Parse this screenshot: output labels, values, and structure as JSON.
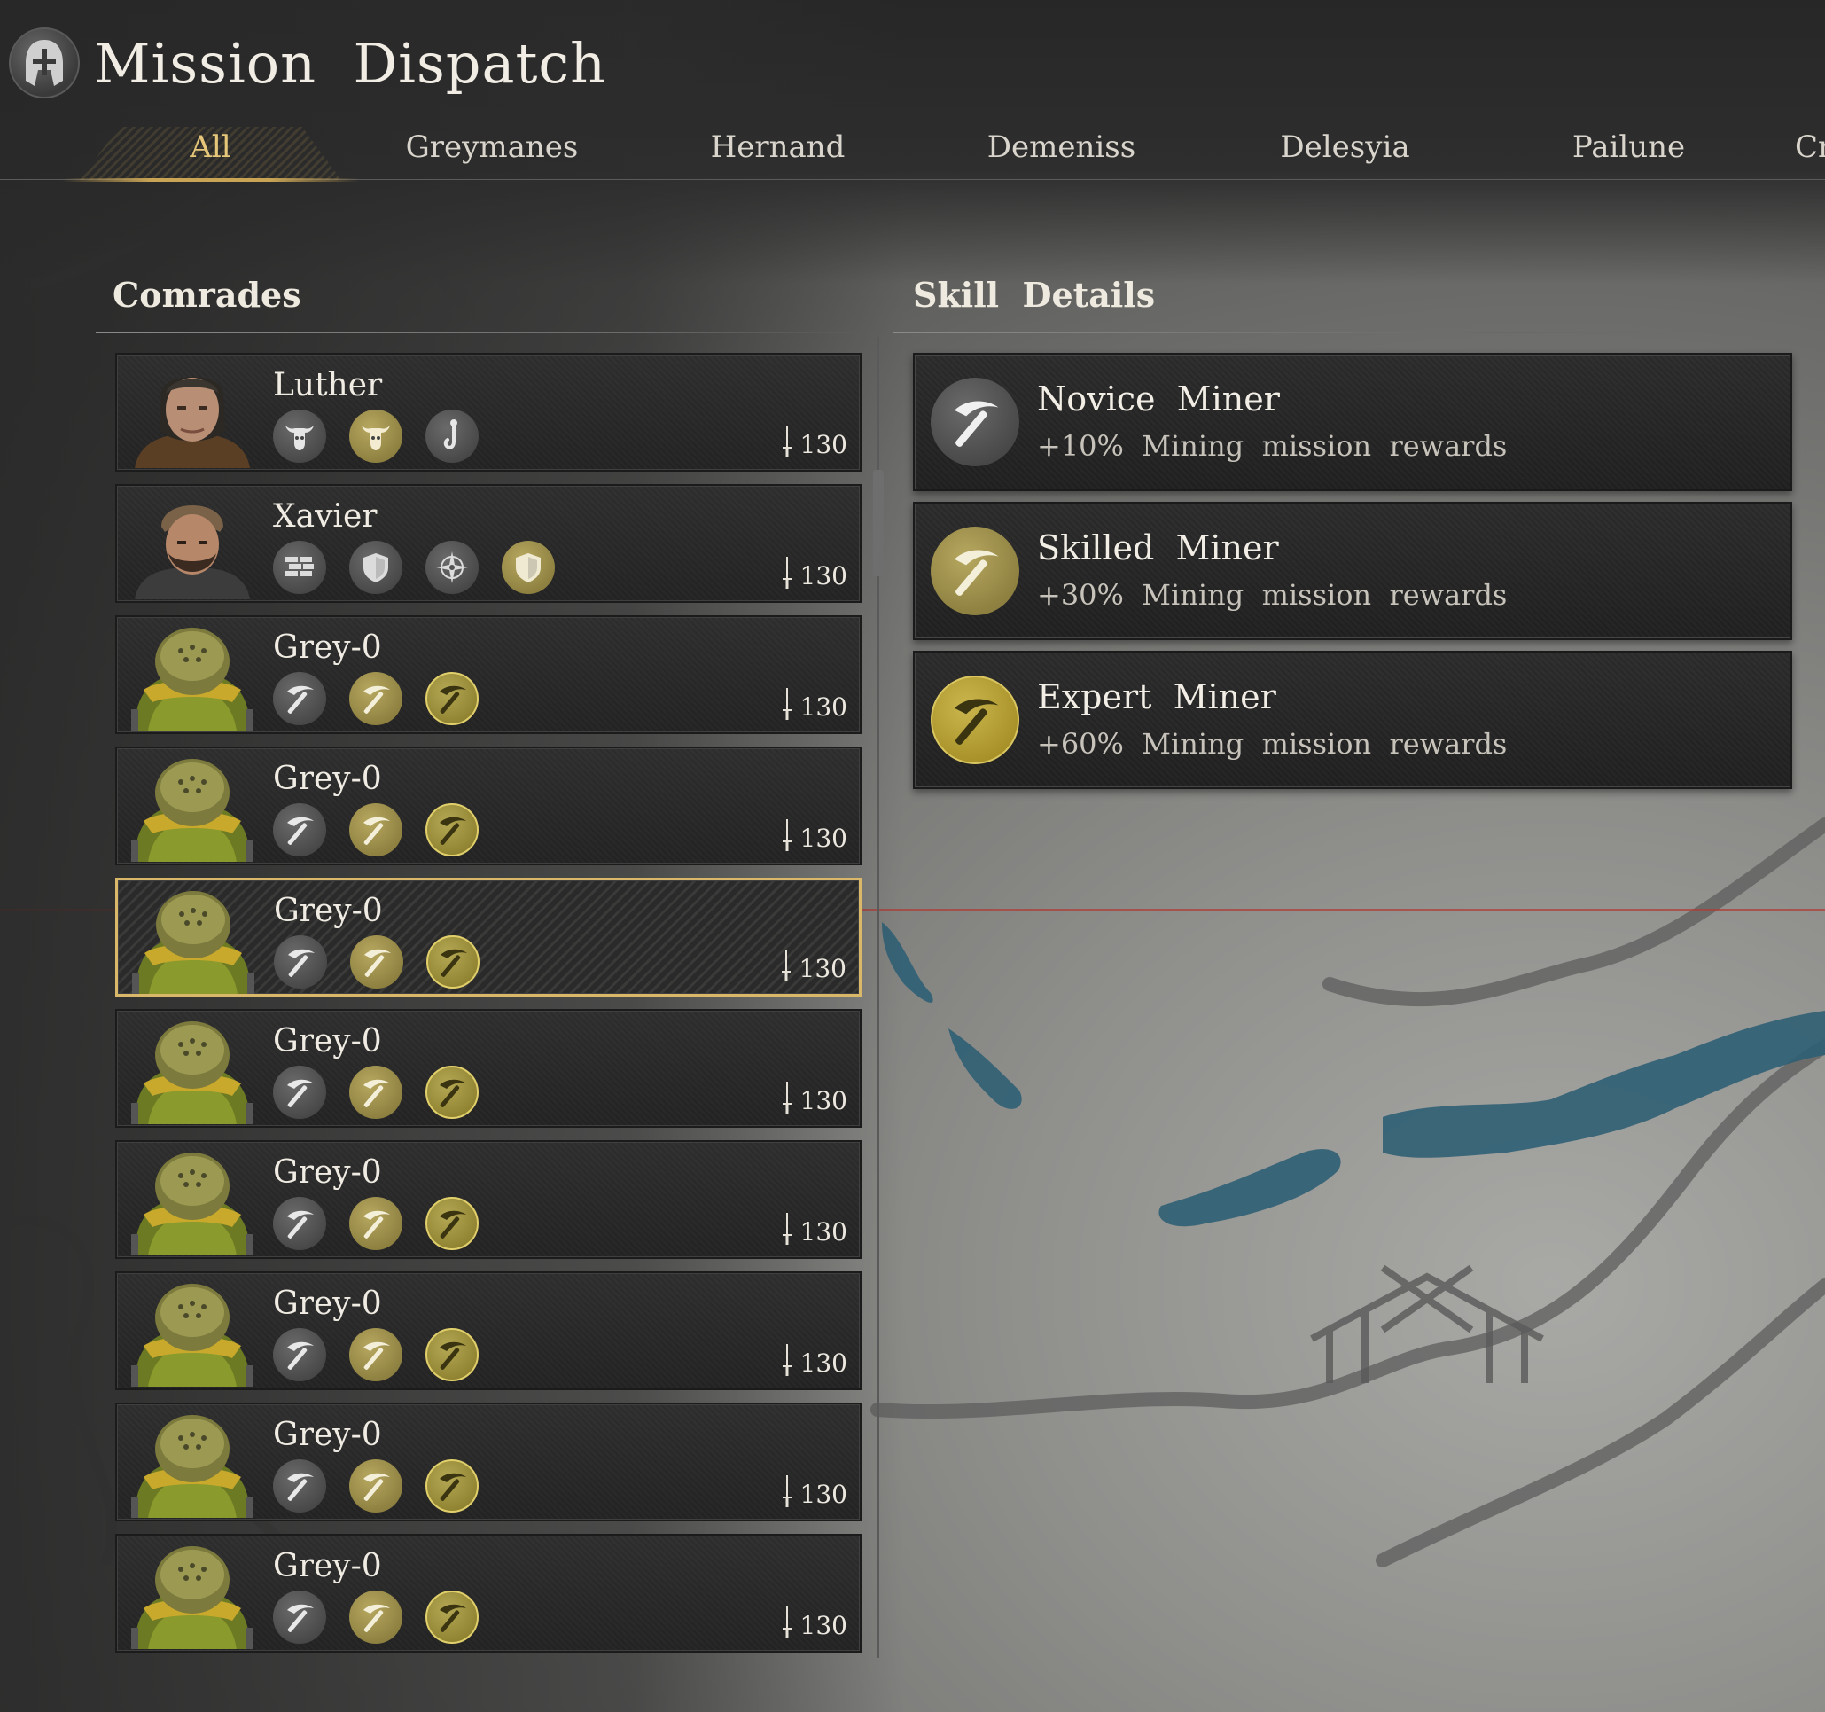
{
  "header": {
    "title": "Mission  Dispatch"
  },
  "tabs": [
    {
      "label": "All",
      "active": true
    },
    {
      "label": "Greymanes",
      "active": false
    },
    {
      "label": "Hernand",
      "active": false
    },
    {
      "label": "Demeniss",
      "active": false
    },
    {
      "label": "Delesyia",
      "active": false
    },
    {
      "label": "Pailune",
      "active": false
    },
    {
      "label": "Cr",
      "active": false
    }
  ],
  "comrades_panel": {
    "title": "Comrades"
  },
  "skills_panel": {
    "title": "Skill  Details"
  },
  "comrades": [
    {
      "name": "Luther",
      "power": "130",
      "portrait": "luther-portrait",
      "skills": [
        "bull-icon",
        "bull-icon",
        "fishing-hook-icon"
      ],
      "selected": false
    },
    {
      "name": "Xavier",
      "power": "130",
      "portrait": "xavier-portrait",
      "skills": [
        "brick-wall-icon",
        "shield-icon",
        "compass-icon",
        "shield-icon"
      ],
      "selected": false
    },
    {
      "name": "Grey-0",
      "power": "130",
      "portrait": "grey-portrait",
      "skills": [
        "pickaxe-icon",
        "pickaxe-icon",
        "pickaxe-icon"
      ],
      "selected": false
    },
    {
      "name": "Grey-0",
      "power": "130",
      "portrait": "grey-portrait",
      "skills": [
        "pickaxe-icon",
        "pickaxe-icon",
        "pickaxe-icon"
      ],
      "selected": false
    },
    {
      "name": "Grey-0",
      "power": "130",
      "portrait": "grey-portrait",
      "skills": [
        "pickaxe-icon",
        "pickaxe-icon",
        "pickaxe-icon"
      ],
      "selected": true
    },
    {
      "name": "Grey-0",
      "power": "130",
      "portrait": "grey-portrait",
      "skills": [
        "pickaxe-icon",
        "pickaxe-icon",
        "pickaxe-icon"
      ],
      "selected": false
    },
    {
      "name": "Grey-0",
      "power": "130",
      "portrait": "grey-portrait",
      "skills": [
        "pickaxe-icon",
        "pickaxe-icon",
        "pickaxe-icon"
      ],
      "selected": false
    },
    {
      "name": "Grey-0",
      "power": "130",
      "portrait": "grey-portrait",
      "skills": [
        "pickaxe-icon",
        "pickaxe-icon",
        "pickaxe-icon"
      ],
      "selected": false
    },
    {
      "name": "Grey-0",
      "power": "130",
      "portrait": "grey-portrait",
      "skills": [
        "pickaxe-icon",
        "pickaxe-icon",
        "pickaxe-icon"
      ],
      "selected": false
    },
    {
      "name": "Grey-0",
      "power": "130",
      "portrait": "grey-portrait",
      "skills": [
        "pickaxe-icon",
        "pickaxe-icon",
        "pickaxe-icon"
      ],
      "selected": false
    }
  ],
  "skill_details": [
    {
      "title": "Novice  Miner",
      "description": "+10%  Mining  mission  rewards",
      "icon": "pickaxe-icon",
      "tier": "grey"
    },
    {
      "title": "Skilled  Miner",
      "description": "+30%  Mining  mission  rewards",
      "icon": "pickaxe-icon",
      "tier": "olive"
    },
    {
      "title": "Expert  Miner",
      "description": "+60%  Mining  mission  rewards",
      "icon": "pickaxe-icon",
      "tier": "gold"
    }
  ],
  "colors": {
    "accent_gold": "#d9b86a",
    "tab_active": "#e6c77a",
    "water": "#2f5f74",
    "marker_line": "#b13a34"
  }
}
